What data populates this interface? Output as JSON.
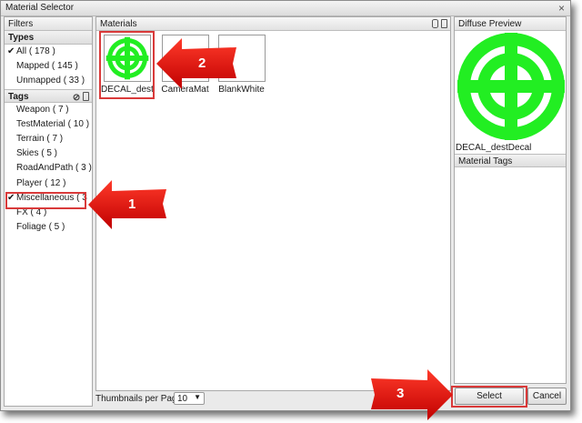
{
  "window": {
    "title": "Material Selector",
    "close_glyph": "×"
  },
  "filters": {
    "header": "Filters",
    "types_header": "Types",
    "types": [
      {
        "label": "All ( 178 )",
        "checked": true
      },
      {
        "label": "Mapped ( 145 )",
        "checked": false
      },
      {
        "label": "Unmapped ( 33 )",
        "checked": false
      }
    ],
    "tags_header": "Tags",
    "tags": [
      {
        "label": "Weapon ( 7 )",
        "checked": false
      },
      {
        "label": "TestMaterial ( 10 )",
        "checked": false
      },
      {
        "label": "Terrain ( 7 )",
        "checked": false
      },
      {
        "label": "Skies ( 5 )",
        "checked": false
      },
      {
        "label": "RoadAndPath ( 3 )",
        "checked": false
      },
      {
        "label": "Player ( 12 )",
        "checked": false
      },
      {
        "label": "Miscellaneous ( 3",
        "checked": true
      },
      {
        "label": "FX ( 4 )",
        "checked": false
      },
      {
        "label": "Foliage ( 5 )",
        "checked": false
      }
    ],
    "check_glyph": "✔"
  },
  "materials": {
    "header": "Materials",
    "items": [
      {
        "label": "DECAL_destD",
        "icon": "target-decal-icon",
        "selected": true
      },
      {
        "label": "CameraMat",
        "icon": "blank-material-icon",
        "selected": false
      },
      {
        "label": "BlankWhite",
        "icon": "blank-material-icon",
        "selected": false
      }
    ],
    "per_page_label": "Thumbnails per Page:",
    "per_page_value": "10"
  },
  "preview": {
    "header": "Diffuse Preview",
    "name": "DECAL_destDecal",
    "tags_header": "Material Tags"
  },
  "buttons": {
    "select": "Select",
    "cancel": "Cancel"
  },
  "callouts": [
    "1",
    "2",
    "3"
  ],
  "colors": {
    "decal_green": "#22ee22",
    "callout_red": "#e01010",
    "highlight": "#d93a3a"
  }
}
